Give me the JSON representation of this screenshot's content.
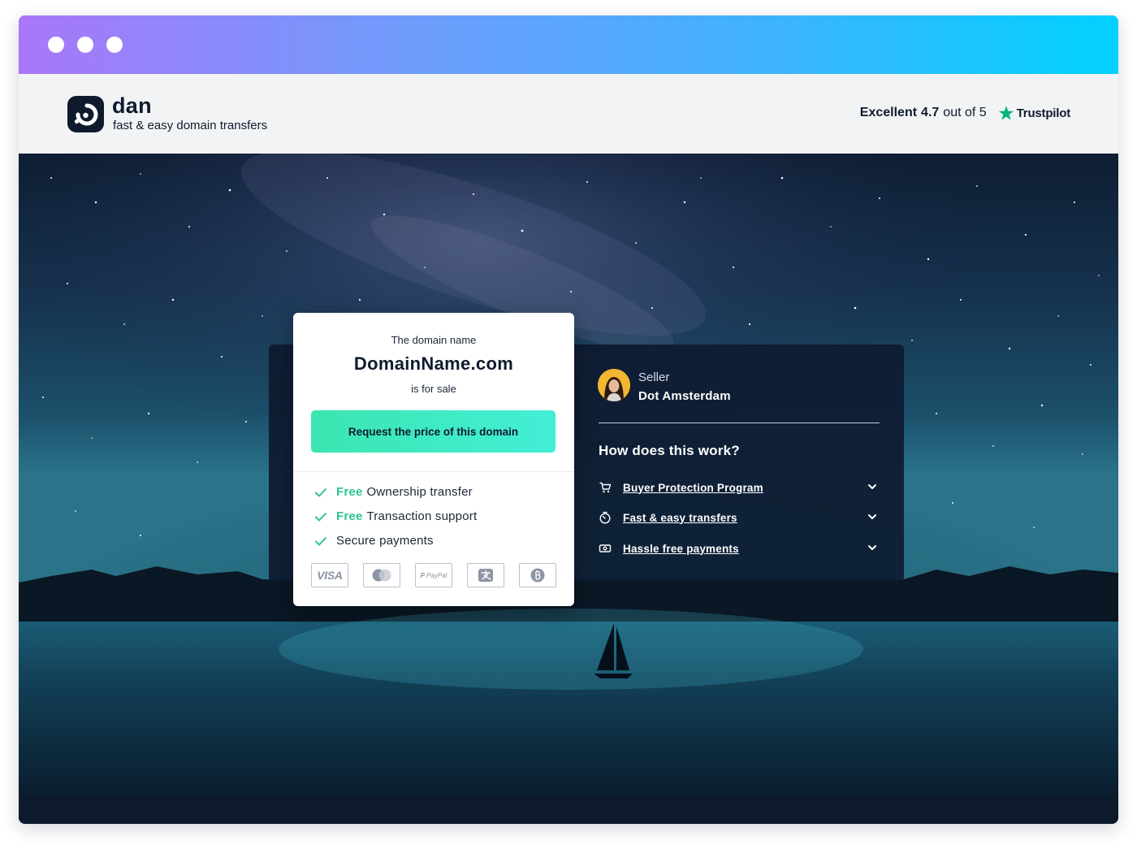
{
  "browser": {
    "colors": {
      "gradient_start": "#a977f8",
      "gradient_end": "#00d1ff"
    }
  },
  "brand": {
    "name": "dan",
    "tagline": "fast & easy domain transfers",
    "logo_icon": "dan-logo-icon"
  },
  "rating": {
    "label": "Excellent",
    "score": "4.7",
    "out_of": "out of 5",
    "provider": "Trustpilot",
    "star_color": "#00b67a"
  },
  "sale_card": {
    "intro": "The domain name",
    "domain": "DomainName.com",
    "status": "is for sale",
    "cta_label": "Request the price of this domain",
    "features": [
      {
        "free": "Free",
        "text": "Ownership transfer"
      },
      {
        "free": "Free",
        "text": "Transaction support"
      },
      {
        "free": "",
        "text": "Secure payments"
      }
    ],
    "payment_methods": [
      {
        "icon": "visa-icon",
        "label": "VISA"
      },
      {
        "icon": "mastercard-icon",
        "label": ""
      },
      {
        "icon": "paypal-icon",
        "label": "PayPal"
      },
      {
        "icon": "alipay-icon",
        "label": ""
      },
      {
        "icon": "bitcoin-icon",
        "label": ""
      }
    ],
    "accent_color": "#2fc48d"
  },
  "seller": {
    "label": "Seller",
    "name": "Dot Amsterdam"
  },
  "how_it_works": {
    "title": "How does this work?",
    "items": [
      {
        "icon": "cart-icon",
        "label": "Buyer Protection Program"
      },
      {
        "icon": "timer-icon",
        "label": "Fast & easy transfers"
      },
      {
        "icon": "cash-icon",
        "label": "Hassle free payments"
      }
    ]
  }
}
